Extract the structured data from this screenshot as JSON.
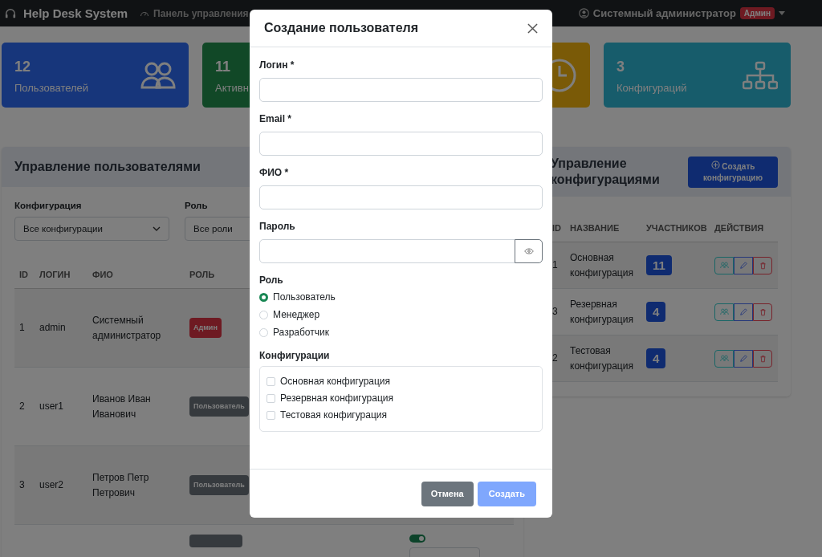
{
  "navbar": {
    "brand": "Help Desk System",
    "nav": [
      {
        "label": "Панель управления"
      }
    ],
    "user": {
      "name": "Системный администратор",
      "badge": "Админ"
    }
  },
  "stat_cards": [
    {
      "kind": "primary",
      "value": "12",
      "label": "Пользователей"
    },
    {
      "kind": "success",
      "value": "11",
      "label": "Активн"
    },
    {
      "kind": "warning"
    },
    {
      "kind": "info",
      "value": "3",
      "label": "Конфигураций"
    }
  ],
  "users_panel": {
    "title": "Управление пользователями",
    "filters": [
      {
        "label": "Конфигурация",
        "value": "Все конфигурации"
      },
      {
        "label": "Роль",
        "value": "Все роли"
      }
    ],
    "columns": [
      "ID",
      "ЛОГИН",
      "ФИО",
      "РОЛЬ"
    ],
    "rows": [
      {
        "id": "1",
        "login": "admin",
        "name": "Системный администратор",
        "role": {
          "kind": "admin",
          "label": "Админ"
        }
      },
      {
        "id": "2",
        "login": "user1",
        "name": "Иванов Иван Иванович",
        "role": {
          "kind": "user",
          "label": "Пользователь"
        }
      },
      {
        "id": "3",
        "login": "user2",
        "name": "Петров Петр Петрович",
        "role": {
          "kind": "user",
          "label": "Пользователь"
        }
      },
      {
        "role": {
          "kind": "user"
        },
        "active": true
      }
    ]
  },
  "config_panel": {
    "title": "Управление конфигурациями",
    "create_button": "Создать конфигурацию",
    "columns": [
      "ID",
      "НАЗВАНИЕ",
      "УЧАСТНИКОВ",
      "ДЕЙСТВИЯ"
    ],
    "rows": [
      {
        "id": "1",
        "name": "Основная конфигурация",
        "members": "11"
      },
      {
        "id": "3",
        "name": "Резервная конфигурация",
        "members": "4"
      },
      {
        "id": "2",
        "name": "Тестовая конфигурация",
        "members": "4"
      }
    ]
  },
  "modal": {
    "title": "Создание пользователя",
    "fields": [
      {
        "label": "Логин *",
        "kind": "text"
      },
      {
        "label": "Email *",
        "kind": "text"
      },
      {
        "label": "ФИО *",
        "kind": "text"
      },
      {
        "label": "Пароль",
        "kind": "password"
      }
    ],
    "role_label": "Роль",
    "roles": [
      {
        "label": "Пользователь",
        "selected": true
      },
      {
        "label": "Менеджер",
        "selected": false
      },
      {
        "label": "Разработчик",
        "selected": false
      }
    ],
    "configs_label": "Конфигурации",
    "configs": [
      {
        "label": "Основная конфигурация",
        "checked": false
      },
      {
        "label": "Резервная конфигурация",
        "checked": false
      },
      {
        "label": "Тестовая конфигурация",
        "checked": false
      }
    ],
    "buttons": [
      {
        "label": "Отмена",
        "kind": "cancel"
      },
      {
        "label": "Создать",
        "kind": "submit"
      }
    ]
  }
}
